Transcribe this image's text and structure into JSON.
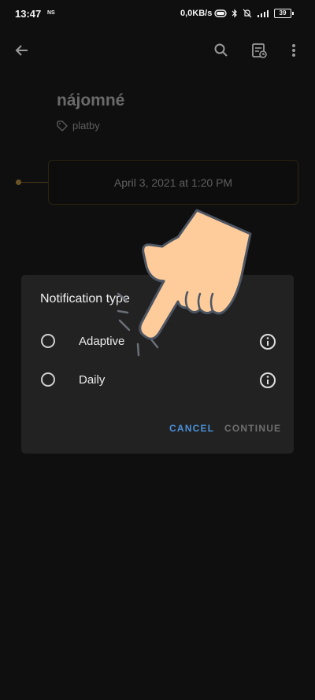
{
  "status_bar": {
    "time": "13:47",
    "ns_label": "NS",
    "net_speed": "0,0KB/s",
    "battery": "39"
  },
  "app_bar": {
    "back_icon": "arrow-back-icon",
    "search_icon": "search-icon",
    "reminder_icon": "reminder-list-icon",
    "more_icon": "more-vert-icon"
  },
  "note": {
    "title": "nájomné",
    "tag": "platby",
    "date": "April 3, 2021 at 1:20 PM"
  },
  "dialog": {
    "title": "Notification type",
    "options": [
      {
        "label": "Adaptive",
        "selected": false
      },
      {
        "label": "Daily",
        "selected": false
      }
    ],
    "cancel_label": "CANCEL",
    "continue_label": "CONTINUE"
  },
  "colors": {
    "accent": "#4a90d9",
    "background": "#0f0f0f",
    "dialog": "#222222",
    "hand": "#fdcc9a"
  }
}
